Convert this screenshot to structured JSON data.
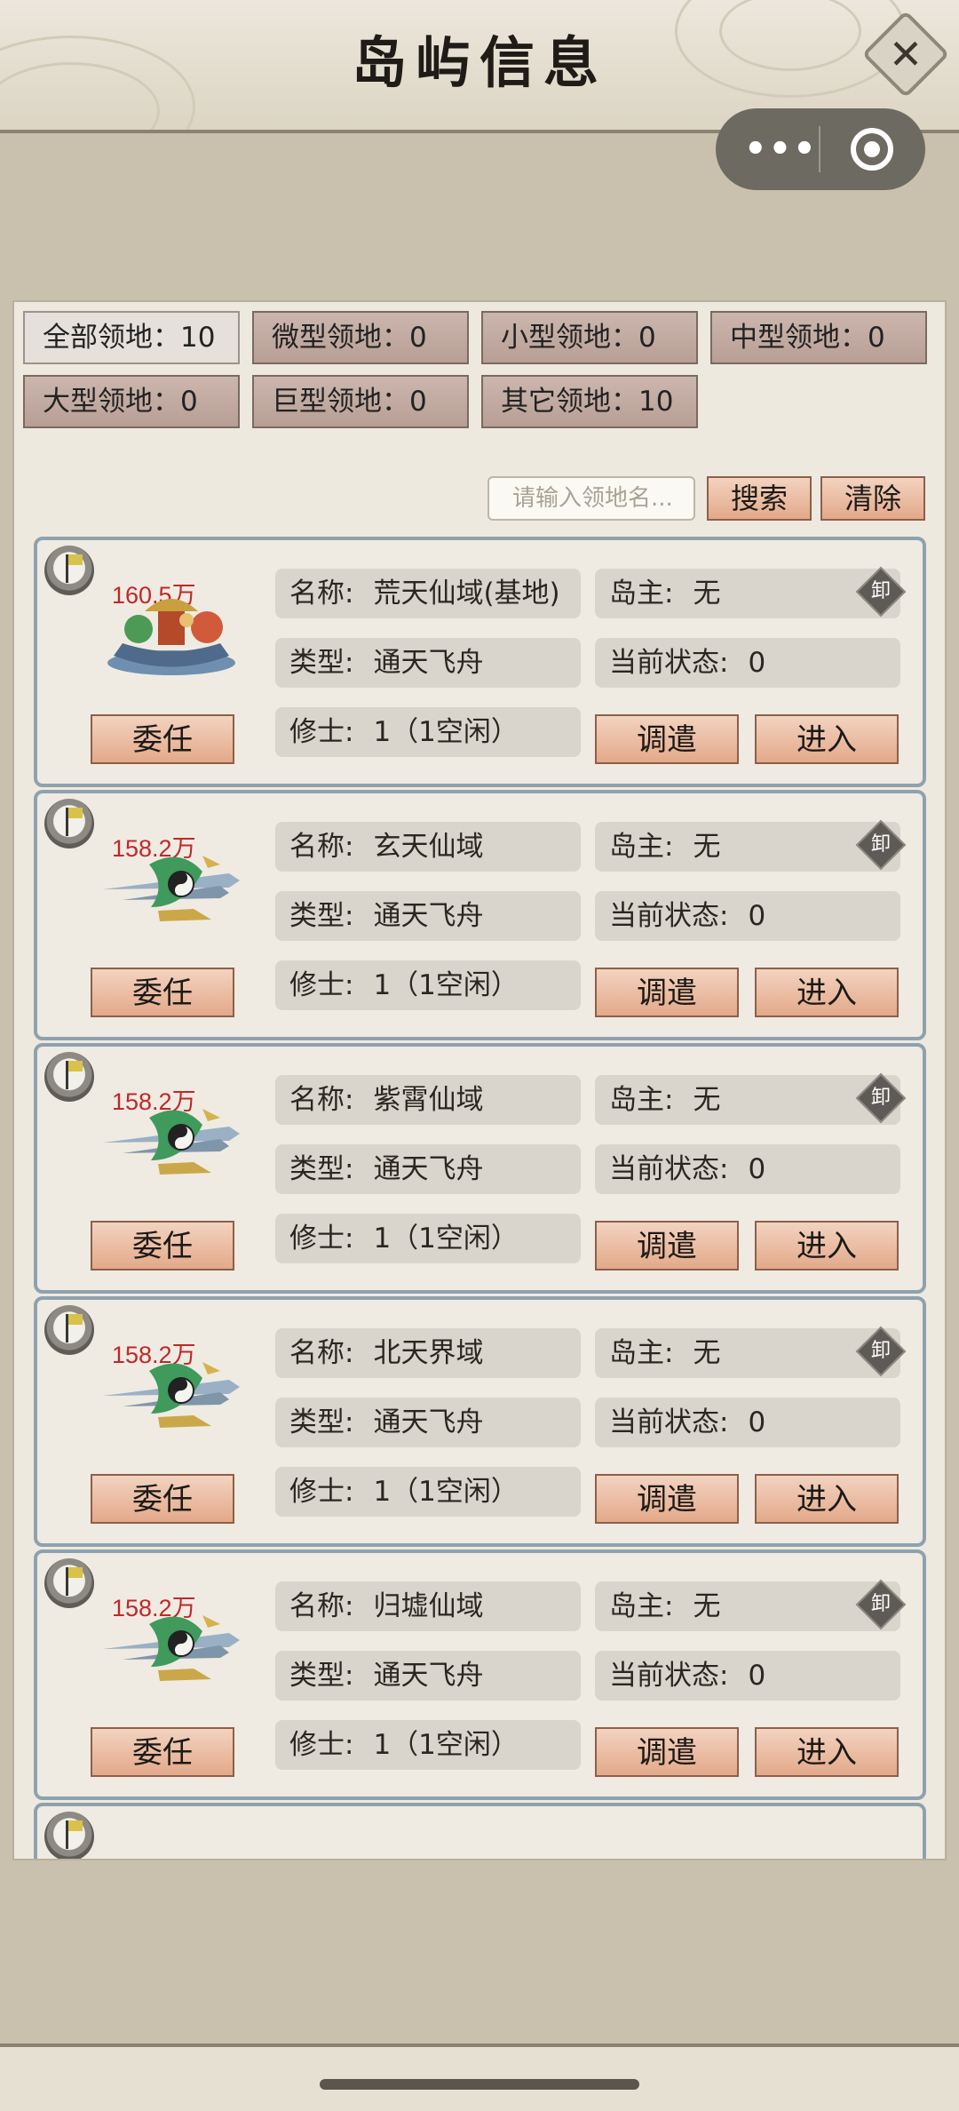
{
  "header": {
    "title": "岛屿信息",
    "close_label": "✕"
  },
  "capsule": {
    "more_label": "•••"
  },
  "filters": [
    {
      "label": "全部领地：10",
      "active": true
    },
    {
      "label": "微型领地：0",
      "active": false
    },
    {
      "label": "小型领地：0",
      "active": false
    },
    {
      "label": "中型领地：0",
      "active": false
    },
    {
      "label": "大型领地：0",
      "active": false
    },
    {
      "label": "巨型领地：0",
      "active": false
    },
    {
      "label": "其它领地：10",
      "active": false
    }
  ],
  "search": {
    "placeholder": "请输入领地名...",
    "search_label": "搜索",
    "clear_label": "清除"
  },
  "labels": {
    "name": "名称:",
    "owner": "岛主:",
    "type": "类型:",
    "status": "当前状态:",
    "cultivator": "修士:",
    "appoint": "委任",
    "dispatch": "调遣",
    "enter": "进入",
    "dismiss": "卸"
  },
  "islands": [
    {
      "power": "160.5万",
      "name": "荒天仙域(基地)",
      "owner": "无",
      "type": "通天飞舟",
      "status": "0",
      "cultivators": "1（1空闲）",
      "icon": "colorful-ship-icon"
    },
    {
      "power": "158.2万",
      "name": "玄天仙域",
      "owner": "无",
      "type": "通天飞舟",
      "status": "0",
      "cultivators": "1（1空闲）",
      "icon": "taiji-sword-ship-icon"
    },
    {
      "power": "158.2万",
      "name": "紫霄仙域",
      "owner": "无",
      "type": "通天飞舟",
      "status": "0",
      "cultivators": "1（1空闲）",
      "icon": "taiji-sword-ship-icon"
    },
    {
      "power": "158.2万",
      "name": "北天界域",
      "owner": "无",
      "type": "通天飞舟",
      "status": "0",
      "cultivators": "1（1空闲）",
      "icon": "taiji-sword-ship-icon"
    },
    {
      "power": "158.2万",
      "name": "归墟仙域",
      "owner": "无",
      "type": "通天飞舟",
      "status": "0",
      "cultivators": "1（1空闲）",
      "icon": "taiji-sword-ship-icon"
    }
  ],
  "colors": {
    "power_text": "#c0282a",
    "button_fill": "#e9b59a",
    "card_border": "#8ea2ae"
  }
}
